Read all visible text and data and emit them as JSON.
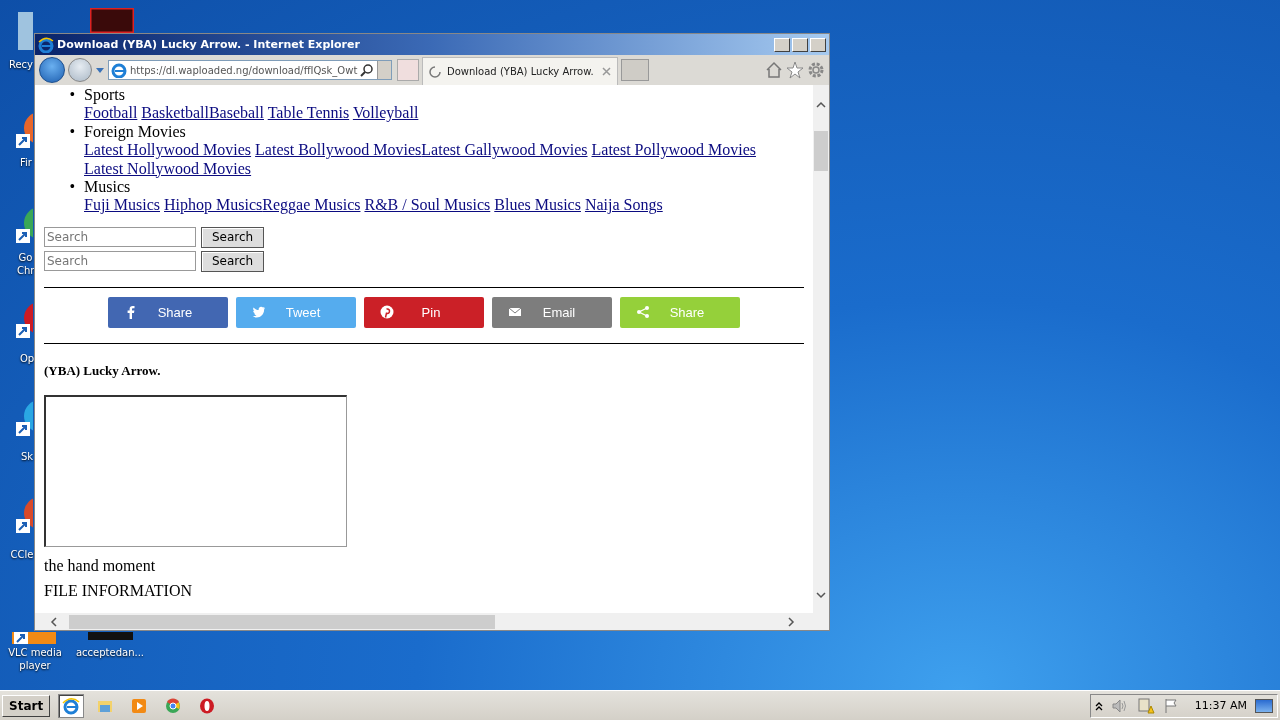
{
  "desktop_icons": [
    {
      "kind": "recycle-bin",
      "label": "Recy"
    },
    {
      "kind": "firefox",
      "label": "Fir"
    },
    {
      "kind": "chrome",
      "label": "Go Chr"
    },
    {
      "kind": "opera",
      "label": "Op"
    },
    {
      "kind": "skype",
      "label": "Sk"
    },
    {
      "kind": "ccleaner",
      "label": "CCle"
    },
    {
      "kind": "vlc",
      "label": "VLC media player"
    },
    {
      "kind": "file",
      "label": "acceptedan..."
    },
    {
      "kind": "app"
    }
  ],
  "window": {
    "title": "Download (YBA) Lucky Arrow. - Internet Explorer",
    "address": "https://dl.waploaded.ng/download/ffIQsk_Owt",
    "tab": {
      "title": "Download (YBA) Lucky Arrow.",
      "loading": true
    }
  },
  "page": {
    "categories": [
      {
        "bullet": "•",
        "name": "Sports",
        "link_groups": [
          [
            "Football"
          ],
          [
            "Basketball",
            "Baseball"
          ],
          [
            "Table Tennis"
          ],
          [
            "Volleyball"
          ]
        ]
      },
      {
        "bullet": "•",
        "name": "Foreign Movies",
        "link_groups": [
          [
            "Latest Hollywood Movies"
          ],
          [
            "Latest Bollywood Movies",
            "Latest Gallywood Movies"
          ],
          [
            "Latest Pollywood Movies"
          ],
          [
            "Latest Nollywood Movies"
          ]
        ]
      },
      {
        "bullet": "•",
        "name": "Musics",
        "link_groups": [
          [
            "Fuji Musics"
          ],
          [
            "Hiphop Musics",
            "Reggae Musics"
          ],
          [
            "R&B / Soul Musics"
          ],
          [
            "Blues Musics"
          ],
          [
            "Naija Songs"
          ]
        ]
      }
    ],
    "searches": [
      {
        "placeholder": "Search",
        "button": "Search"
      },
      {
        "placeholder": "Search",
        "button": "Search"
      }
    ],
    "share_buttons": [
      {
        "kind": "facebook",
        "label": "Share",
        "color": "#4267b2"
      },
      {
        "kind": "twitter",
        "label": "Tweet",
        "color": "#55acee"
      },
      {
        "kind": "pinterest",
        "label": "Pin",
        "color": "#cb2027"
      },
      {
        "kind": "email",
        "label": "Email",
        "color": "#7d7d7d"
      },
      {
        "kind": "share",
        "label": "Share",
        "color": "#95d03a"
      }
    ],
    "title": "(YBA) Lucky Arrow.",
    "description": "the hand moment",
    "section_heading": "FILE INFORMATION"
  },
  "taskbar": {
    "start": "Start",
    "apps": [
      {
        "kind": "ie",
        "selected": true
      },
      {
        "kind": "explorer",
        "selected": false
      },
      {
        "kind": "media",
        "selected": false
      },
      {
        "kind": "chrome",
        "selected": false
      },
      {
        "kind": "opera",
        "selected": false
      }
    ],
    "clock": "11:37 AM"
  }
}
